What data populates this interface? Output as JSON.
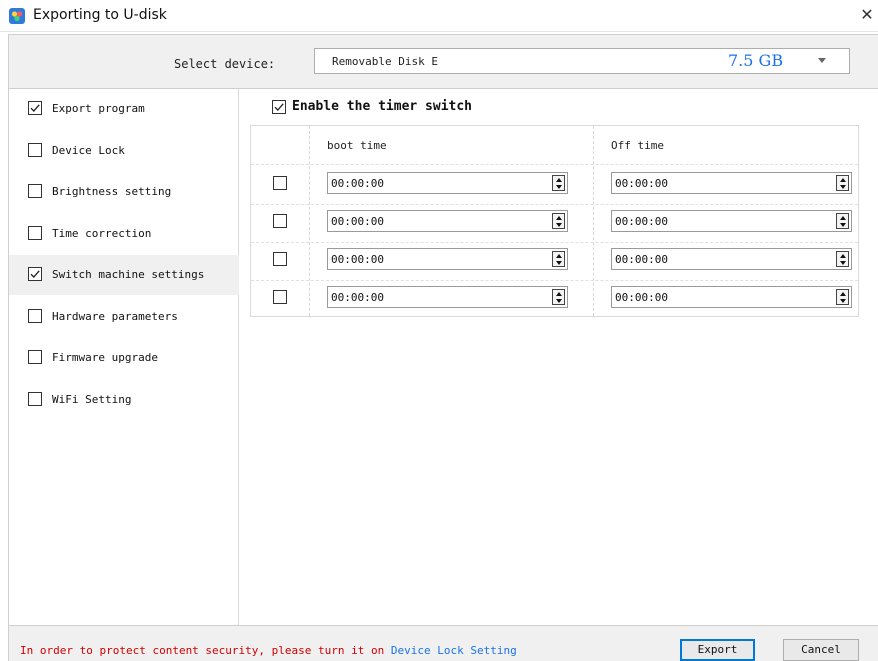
{
  "window": {
    "title": "Exporting to U-disk",
    "close_glyph": "✕"
  },
  "device": {
    "label": "Select device:",
    "name": "Removable Disk E",
    "size": "7.5 GB"
  },
  "sidebar": {
    "items": [
      {
        "label": "Export program",
        "checked": true,
        "active": false
      },
      {
        "label": "Device Lock",
        "checked": false,
        "active": false
      },
      {
        "label": "Brightness setting",
        "checked": false,
        "active": false
      },
      {
        "label": "Time correction",
        "checked": false,
        "active": false
      },
      {
        "label": "Switch machine settings",
        "checked": true,
        "active": true
      },
      {
        "label": "Hardware parameters",
        "checked": false,
        "active": false
      },
      {
        "label": "Firmware upgrade",
        "checked": false,
        "active": false
      },
      {
        "label": "WiFi Setting",
        "checked": false,
        "active": false
      }
    ]
  },
  "timer": {
    "enable_label": "Enable the timer switch",
    "enabled": true,
    "columns": {
      "boot": "boot time",
      "off": "Off time"
    },
    "rows": [
      {
        "checked": false,
        "boot": "00:00:00",
        "off": "00:00:00"
      },
      {
        "checked": false,
        "boot": "00:00:00",
        "off": "00:00:00"
      },
      {
        "checked": false,
        "boot": "00:00:00",
        "off": "00:00:00"
      },
      {
        "checked": false,
        "boot": "00:00:00",
        "off": "00:00:00"
      }
    ]
  },
  "footer": {
    "notice": "In order to protect content security, please turn it on",
    "notice_link": "Device Lock Setting",
    "export_label": "Export",
    "cancel_label": "Cancel"
  },
  "colors": {
    "accent": "#1a73e8",
    "warning": "#d10000",
    "panel_bg": "#f0f0f0"
  },
  "icons": {
    "app": "app-logo-icon",
    "close": "close-icon",
    "dropdown": "chevron-down-icon",
    "check": "checkmark-icon",
    "spin": "spinner-updown-icon"
  }
}
